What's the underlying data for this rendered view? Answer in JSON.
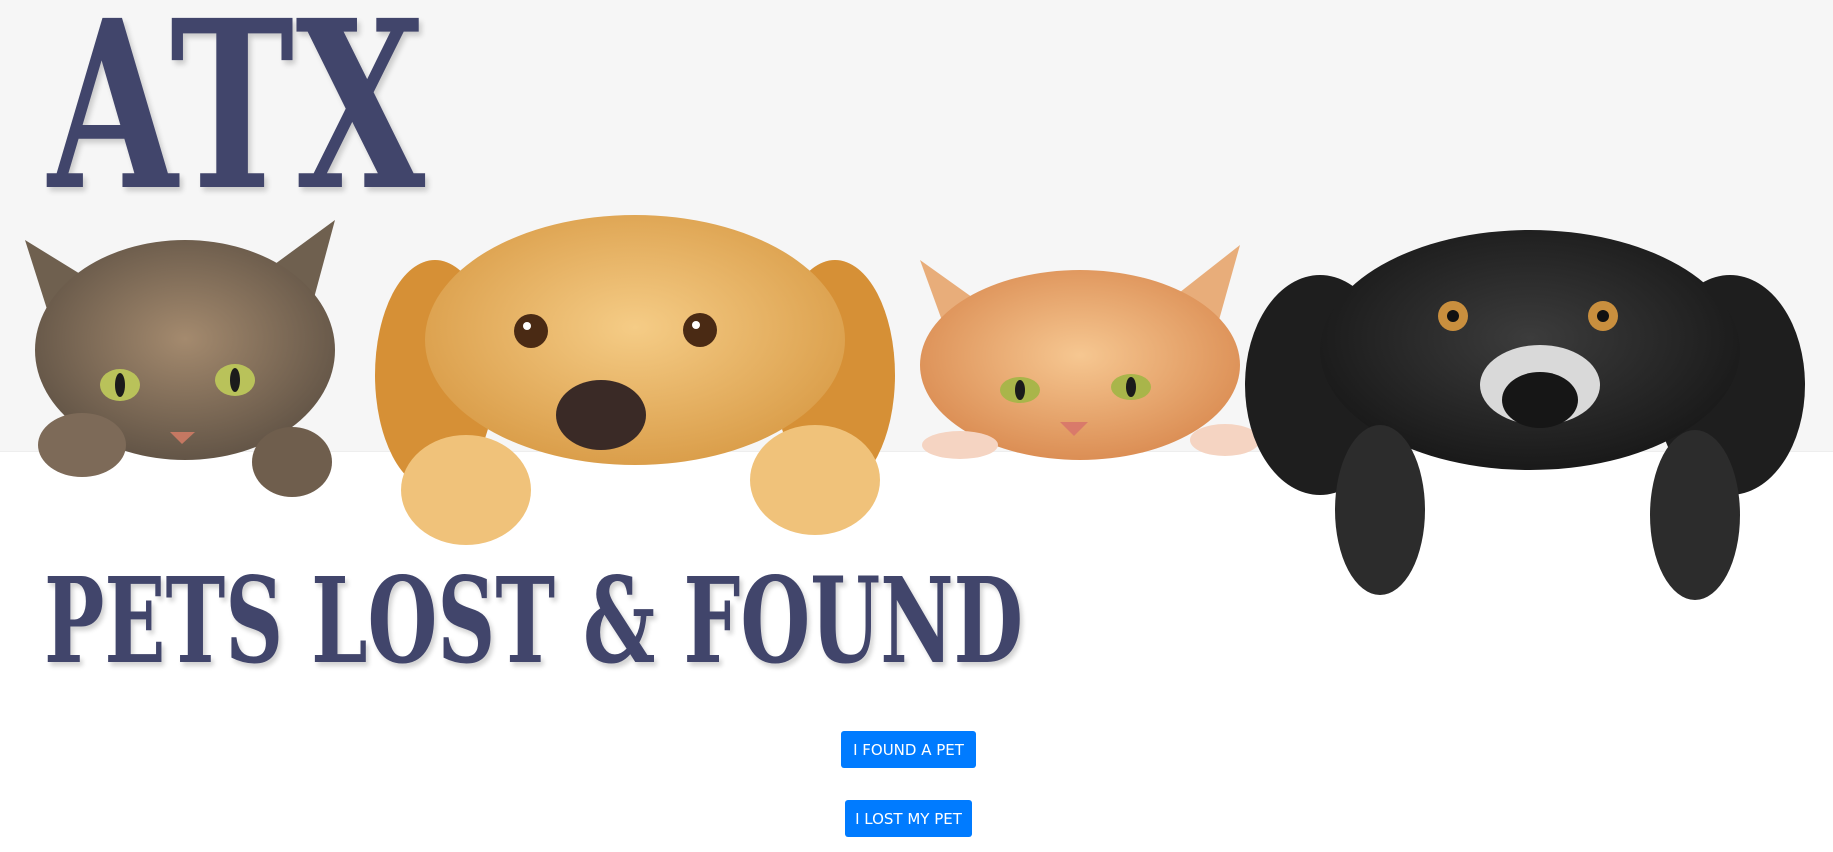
{
  "header": {
    "brand_title": "ATX",
    "brand_subtitle": "PETS LOST & FOUND",
    "title_color": "#41456b",
    "image_subject": "two cats and two dogs peeking over a white ledge"
  },
  "actions": {
    "found_label": "I FOUND A PET",
    "lost_label": "I LOST MY PET",
    "accent": "#007bff"
  }
}
